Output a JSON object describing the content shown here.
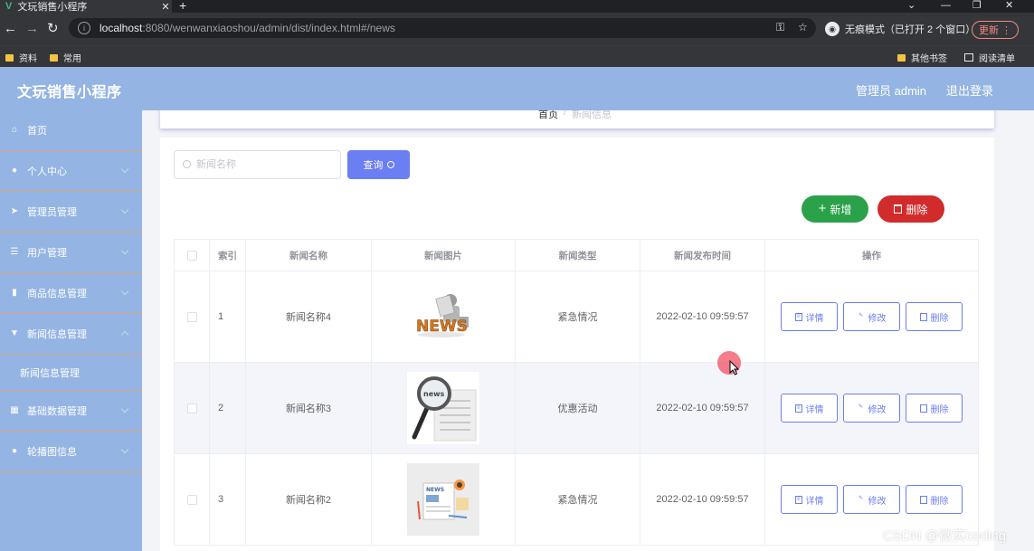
{
  "browser": {
    "tab_title": "文玩销售小程序",
    "new_tab_label": "+",
    "url_host": "localhost",
    "url_rest": ":8080/wenwanxiaoshou/admin/dist/index.html#/news",
    "incognito_label": "无痕模式（已打开 2 个窗口）",
    "update_label": "更新",
    "bookmarks": [
      "资料",
      "常用"
    ],
    "bookmarks_right": [
      "其他书签",
      "阅读清单"
    ]
  },
  "header": {
    "title": "文玩销售小程序",
    "admin_label": "管理员 admin",
    "logout_label": "退出登录"
  },
  "sidebar": {
    "items": [
      {
        "label": "首页",
        "icon": "home-icon"
      },
      {
        "label": "个人中心",
        "icon": "user-icon"
      },
      {
        "label": "管理员管理",
        "icon": "send-icon"
      },
      {
        "label": "用户管理",
        "icon": "menu-icon"
      },
      {
        "label": "商品信息管理",
        "icon": "chart-icon"
      },
      {
        "label": "新闻信息管理",
        "icon": "news-icon"
      },
      {
        "label": "基础数据管理",
        "icon": "grid-icon"
      },
      {
        "label": "轮播图信息",
        "icon": "user-icon"
      }
    ],
    "submenu": "新闻信息管理"
  },
  "breadcrumb": {
    "home": "首页",
    "separator": "/",
    "current": "新闻信息"
  },
  "search": {
    "placeholder": "新闻名称",
    "button_label": "查询"
  },
  "actions": {
    "add_label": "新增",
    "delete_label": "删除"
  },
  "table": {
    "headers": {
      "index": "索引",
      "name": "新闻名称",
      "image": "新闻图片",
      "type": "新闻类型",
      "time": "新闻发布时间",
      "ops": "操作"
    },
    "rows": [
      {
        "index": "1",
        "name": "新闻名称4",
        "type": "紧急情况",
        "time": "2022-02-10 09:59:57"
      },
      {
        "index": "2",
        "name": "新闻名称3",
        "type": "优惠活动",
        "time": "2022-02-10 09:59:57"
      },
      {
        "index": "3",
        "name": "新闻名称2",
        "type": "紧急情况",
        "time": "2022-02-10 09:59:57"
      }
    ],
    "op_labels": {
      "detail": "详情",
      "edit": "修改",
      "delete": "删除"
    }
  },
  "watermark": "CSDN @微实coding",
  "colors": {
    "header_bg": "#94b4e3",
    "primary": "#6b7ef2",
    "success": "#2ba14a",
    "danger": "#d12b2b"
  }
}
